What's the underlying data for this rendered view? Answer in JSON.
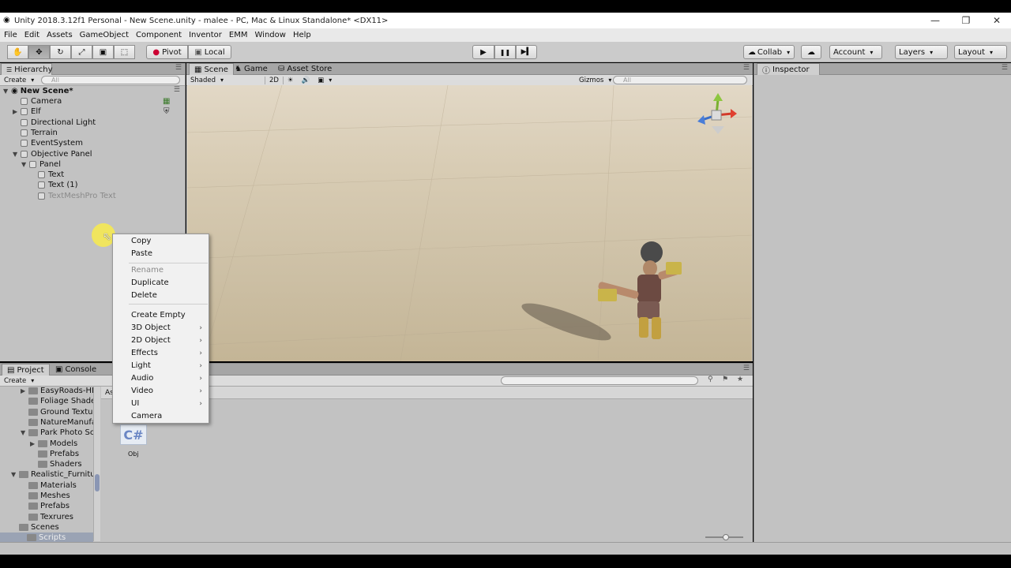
{
  "window": {
    "title": "Unity 2018.3.12f1 Personal - New Scene.unity - malee - PC, Mac & Linux Standalone* <DX11>",
    "minimize": "—",
    "maximize": "❐",
    "close": "✕"
  },
  "menu": [
    "File",
    "Edit",
    "Assets",
    "GameObject",
    "Component",
    "Inventor",
    "EMM",
    "Window",
    "Help"
  ],
  "toolbar": {
    "tool_icons": [
      "hand-icon",
      "move-icon",
      "rotate-icon",
      "scale-icon",
      "rect-icon",
      "transform-icon"
    ],
    "pivot": "Pivot",
    "local": "Local",
    "play": "▶",
    "pause": "❚❚",
    "step": "▶▍",
    "collab": "Collab",
    "cloud": "☁",
    "account": "Account",
    "layers": "Layers",
    "layout": "Layout"
  },
  "hierarchy": {
    "tab": "Hierarchy",
    "create": "Create",
    "search_placeholder": "All",
    "scene_name": "New Scene*",
    "items": [
      {
        "label": "Camera",
        "indent": 0,
        "arrow": "",
        "dim": false
      },
      {
        "label": "Elf",
        "indent": 0,
        "arrow": "▶",
        "dim": false
      },
      {
        "label": "Directional Light",
        "indent": 0,
        "arrow": "",
        "dim": false
      },
      {
        "label": "Terrain",
        "indent": 0,
        "arrow": "",
        "dim": false
      },
      {
        "label": "EventSystem",
        "indent": 0,
        "arrow": "",
        "dim": false
      },
      {
        "label": "Objective Panel",
        "indent": 0,
        "arrow": "▼",
        "dim": false
      },
      {
        "label": "Panel",
        "indent": 1,
        "arrow": "▼",
        "dim": false
      },
      {
        "label": "Text",
        "indent": 2,
        "arrow": "",
        "dim": false
      },
      {
        "label": "Text (1)",
        "indent": 2,
        "arrow": "",
        "dim": false
      },
      {
        "label": "TextMeshPro Text",
        "indent": 2,
        "arrow": "",
        "dim": true
      }
    ]
  },
  "scene": {
    "tabs": [
      "Scene",
      "Game",
      "Asset Store"
    ],
    "shading": "Shaded",
    "mode_2d": "2D",
    "gizmos": "Gizmos",
    "search_placeholder": "All"
  },
  "inspector": {
    "tab": "Inspector"
  },
  "context_menu": {
    "items": [
      {
        "label": "Copy",
        "disabled": false,
        "submenu": false
      },
      {
        "label": "Paste",
        "disabled": false,
        "submenu": false
      },
      {
        "label": "Rename",
        "disabled": true,
        "submenu": false
      },
      {
        "label": "Duplicate",
        "disabled": false,
        "submenu": false
      },
      {
        "label": "Delete",
        "disabled": false,
        "submenu": false
      },
      {
        "label": "Create Empty",
        "disabled": false,
        "submenu": false
      },
      {
        "label": "3D Object",
        "disabled": false,
        "submenu": true
      },
      {
        "label": "2D Object",
        "disabled": false,
        "submenu": true
      },
      {
        "label": "Effects",
        "disabled": false,
        "submenu": true
      },
      {
        "label": "Light",
        "disabled": false,
        "submenu": true
      },
      {
        "label": "Audio",
        "disabled": false,
        "submenu": true
      },
      {
        "label": "Video",
        "disabled": false,
        "submenu": true
      },
      {
        "label": "UI",
        "disabled": false,
        "submenu": true
      },
      {
        "label": "Camera",
        "disabled": false,
        "submenu": false
      }
    ]
  },
  "project": {
    "tabs": [
      "Project",
      "Console"
    ],
    "create": "Create",
    "folders": [
      {
        "label": "EasyRoads-HI",
        "indent": 1,
        "arrow": "▶"
      },
      {
        "label": "Foliage Shade",
        "indent": 1,
        "arrow": ""
      },
      {
        "label": "Ground Textu",
        "indent": 1,
        "arrow": ""
      },
      {
        "label": "NatureManufa",
        "indent": 1,
        "arrow": ""
      },
      {
        "label": "Park Photo Sc",
        "indent": 1,
        "arrow": "▼"
      },
      {
        "label": "Models",
        "indent": 2,
        "arrow": "▶"
      },
      {
        "label": "Prefabs",
        "indent": 2,
        "arrow": ""
      },
      {
        "label": "Shaders",
        "indent": 2,
        "arrow": ""
      },
      {
        "label": "Realistic_Furnitu",
        "indent": 0,
        "arrow": "▼"
      },
      {
        "label": "Materials",
        "indent": 1,
        "arrow": ""
      },
      {
        "label": "Meshes",
        "indent": 1,
        "arrow": ""
      },
      {
        "label": "Prefabs",
        "indent": 1,
        "arrow": ""
      },
      {
        "label": "Texrures",
        "indent": 1,
        "arrow": ""
      },
      {
        "label": "Scenes",
        "indent": 0,
        "arrow": ""
      },
      {
        "label": "Scripts",
        "indent": 0,
        "arrow": ""
      }
    ],
    "breadcrumb": "As",
    "asset_icon": "C#",
    "asset_label": "Obj"
  }
}
